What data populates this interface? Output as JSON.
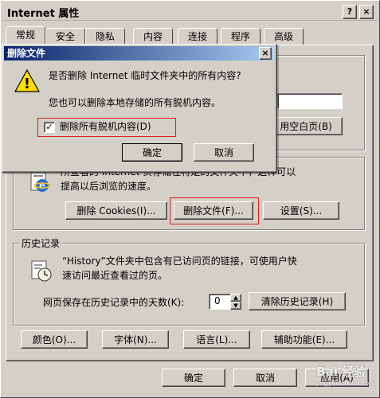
{
  "window": {
    "title": "Internet 属性",
    "help_glyph": "?",
    "close_glyph": "×"
  },
  "tabs": [
    {
      "label": "常规",
      "active": true
    },
    {
      "label": "安全"
    },
    {
      "label": "隐私"
    },
    {
      "label": "内容"
    },
    {
      "label": "连接"
    },
    {
      "label": "程序"
    },
    {
      "label": "高级"
    }
  ],
  "homepage": {
    "use_blank_button": "用空白页(B)"
  },
  "temp_files": {
    "desc_line1": "所查看的 Internet 页存储在特定的文件夹中，这样可以",
    "desc_line2": "提高以后浏览的速度。",
    "delete_cookies_button": "删除 Cookies(I)...",
    "delete_files_button": "删除文件(F)...",
    "settings_button": "设置(S)..."
  },
  "history": {
    "group_label": "历史记录",
    "desc_line1": "“History”文件夹中包含有已访问页的链接，可使用户快",
    "desc_line2": "速访问最近查看过的页。",
    "days_label": "网页保存在历史记录中的天数(K):",
    "days_value": "0",
    "clear_button": "清除历史记录(H)"
  },
  "bottom_buttons": {
    "colors": "颜色(O)...",
    "fonts": "字体(N)...",
    "languages": "语言(L)...",
    "accessibility": "辅助功能(E)..."
  },
  "dialog_buttons": {
    "ok": "确定",
    "cancel": "取消",
    "apply": "应用(A)"
  },
  "delete_dialog": {
    "title": "删除文件",
    "question": "是否删除 Internet 临时文件夹中的所有内容?",
    "hint": "您也可以删除本地存储的所有脱机内容。",
    "checkbox_label": "删除所有脱机内容(D)",
    "checked": true,
    "check_glyph": "✓",
    "warning_glyph": "!",
    "ok": "确定",
    "cancel": "取消"
  },
  "watermark": {
    "text": "Bai 经验",
    "url": "jingyan.baidu.com"
  },
  "colors": {
    "face": "#d4d0c8",
    "highlight_box": "#d8201c",
    "dialog_title": "#0a246a"
  }
}
